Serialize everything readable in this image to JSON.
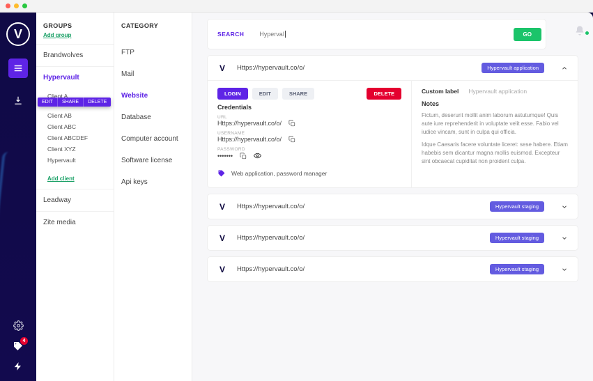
{
  "search": {
    "label": "SEARCH",
    "value": "Hyperva",
    "go": "GO"
  },
  "rail": {
    "badge": "4"
  },
  "groups": {
    "title": "GROUPS",
    "add_group": "Add group",
    "add_client": "Add client",
    "items": [
      {
        "label": "Brandwolves"
      },
      {
        "label": "Hypervault",
        "active": true,
        "clients": [
          "Client A",
          "Client AB",
          "Client ABC",
          "Client ABCDEF",
          "Client XYZ",
          "Hypervault"
        ]
      },
      {
        "label": "Leadway"
      },
      {
        "label": "Zite media"
      }
    ],
    "context_menu": [
      "EDIT",
      "SHARE",
      "DELETE"
    ]
  },
  "category": {
    "title": "CATEGORY",
    "items": [
      "FTP",
      "Mail",
      "Website",
      "Database",
      "Computer account",
      "Software license",
      "Api keys"
    ],
    "active_index": 2
  },
  "record": {
    "url": "Https://hypervault.co/o/",
    "badge": "Hypervault application",
    "actions": {
      "login": "LOGIN",
      "edit": "EDIT",
      "share": "SHARE",
      "delete": "DELETE"
    },
    "credentials_title": "Credentials",
    "fields": {
      "url_label": "URL",
      "url_value": "Https://hypervault.co/o/",
      "user_label": "USERNAME",
      "user_value": "Https://hypervault.co/o/",
      "pass_label": "PASSWORD",
      "pass_value": "•••••••"
    },
    "tags": "Web application, password manager",
    "custom_label": "Custom label",
    "custom_value": "Hypervault application",
    "notes_title": "Notes",
    "notes_p1": "Fictum, deserunt mollit anim laborum astutumque! Quis aute iure reprehenderit in voluptate velit esse. Fabio vel iudice vincam, sunt in culpa qui officia.",
    "notes_p2": "Idque Caesaris facere voluntate liceret: sese habere. Etiam habebis sem dicantur magna mollis euismod. Excepteur sint obcaecat cupiditat non proident culpa."
  },
  "collapsed_records": [
    {
      "url": "Https://hypervault.co/o/",
      "badge": "Hypervault staging"
    },
    {
      "url": "Https://hypervault.co/o/",
      "badge": "Hypervault staging"
    },
    {
      "url": "Https://hypervault.co/o/",
      "badge": "Hypervault staging"
    }
  ]
}
